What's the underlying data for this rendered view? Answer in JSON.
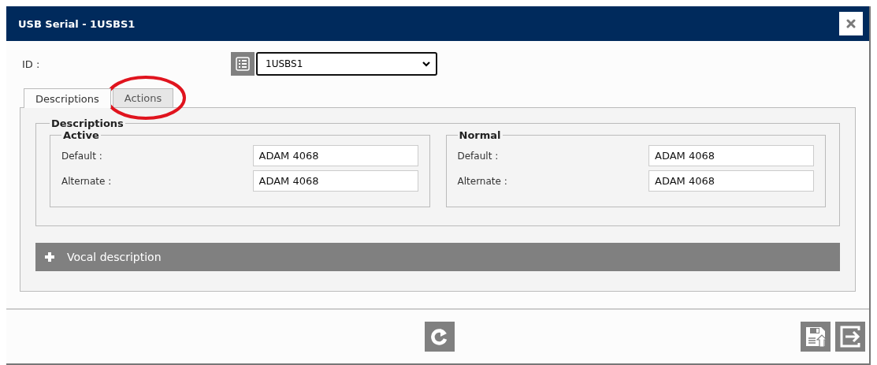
{
  "window": {
    "title": "USB Serial - 1USBS1"
  },
  "id_field": {
    "label": "ID :",
    "value": "1USBS1"
  },
  "tabs": [
    {
      "label": "Descriptions",
      "selected": true,
      "circled": false
    },
    {
      "label": "Actions",
      "selected": false,
      "circled": true
    }
  ],
  "descriptions": {
    "legend": "Descriptions",
    "groups": [
      {
        "legend": "Active",
        "fields": [
          {
            "label": "Default :",
            "value": "ADAM 4068"
          },
          {
            "label": "Alternate :",
            "value": "ADAM 4068"
          }
        ]
      },
      {
        "legend": "Normal",
        "fields": [
          {
            "label": "Default :",
            "value": "ADAM 4068"
          },
          {
            "label": "Alternate :",
            "value": "ADAM 4068"
          }
        ]
      }
    ]
  },
  "vocal_section": {
    "label": "Vocal description",
    "expanded": false
  }
}
